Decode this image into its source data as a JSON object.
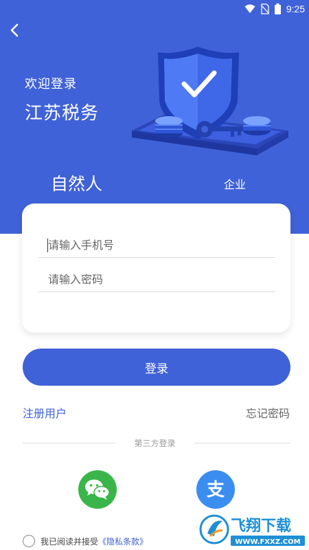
{
  "status_bar": {
    "time": "9:25",
    "icons": [
      "wifi-icon",
      "no-sim-icon",
      "battery-icon"
    ]
  },
  "header": {
    "back_icon": "chevron-left-icon",
    "welcome": "欢迎登录",
    "brand": "江苏税务"
  },
  "tabs": [
    {
      "label": "自然人",
      "active": true
    },
    {
      "label": "企业",
      "active": false
    }
  ],
  "form": {
    "phone_placeholder": "请输入手机号",
    "phone_value": "",
    "password_placeholder": "请输入密码",
    "password_value": ""
  },
  "login_button": "登录",
  "links": {
    "register": "注册用户",
    "forgot": "忘记密码"
  },
  "third_party": {
    "label": "第三方登录",
    "providers": [
      {
        "name": "wechat",
        "icon": "wechat-icon"
      },
      {
        "name": "alipay",
        "icon": "alipay-icon",
        "glyph": "支"
      }
    ]
  },
  "agreement": {
    "text": "我已阅读并接受",
    "link": "《隐私条款》",
    "checked": false
  },
  "watermark": {
    "title": "飞翔下载",
    "url": "WWW.FXXZ.COM"
  },
  "colors": {
    "primary": "#4062d8",
    "link": "#3c5fd4",
    "wechat": "#3ab54a",
    "alipay": "#3b8ef0"
  }
}
